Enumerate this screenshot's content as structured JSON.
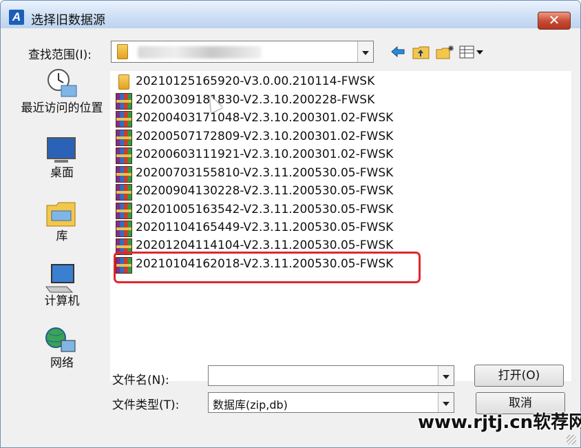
{
  "window": {
    "title": "选择旧数据源",
    "app_icon_letter": "A",
    "close_glyph": "✕"
  },
  "lookin": {
    "label": "查找范围(I):",
    "value": ""
  },
  "toolbar": {
    "back_icon": "back-arrow-icon",
    "up_icon": "up-folder-icon",
    "new_folder_icon": "new-folder-icon",
    "views_icon": "view-menu-icon"
  },
  "places": [
    {
      "label": "最近访问的位置",
      "icon": "recent-places-icon"
    },
    {
      "label": "桌面",
      "icon": "desktop-icon"
    },
    {
      "label": "库",
      "icon": "libraries-icon"
    },
    {
      "label": "计算机",
      "icon": "computer-icon"
    },
    {
      "label": "网络",
      "icon": "network-icon"
    }
  ],
  "files": [
    {
      "name": "20210125165920-V3.0.00.210114-FWSK",
      "type": "folder"
    },
    {
      "name": "20200309181830-V2.3.10.200228-FWSK",
      "type": "rar"
    },
    {
      "name": "20200403171048-V2.3.10.200301.02-FWSK",
      "type": "rar"
    },
    {
      "name": "20200507172809-V2.3.10.200301.02-FWSK",
      "type": "rar"
    },
    {
      "name": "20200603111921-V2.3.10.200301.02-FWSK",
      "type": "rar"
    },
    {
      "name": "20200703155810-V2.3.11.200530.05-FWSK",
      "type": "rar"
    },
    {
      "name": "20200904130228-V2.3.11.200530.05-FWSK",
      "type": "rar"
    },
    {
      "name": "20201005163542-V2.3.11.200530.05-FWSK",
      "type": "rar"
    },
    {
      "name": "20201104165449-V2.3.11.200530.05-FWSK",
      "type": "rar"
    },
    {
      "name": "20201204114104-V2.3.11.200530.05-FWSK",
      "type": "rar"
    },
    {
      "name": "20210104162018-V2.3.11.200530.05-FWSK",
      "type": "rar",
      "highlighted": true
    }
  ],
  "filename": {
    "label": "文件名(N):",
    "value": ""
  },
  "filetype": {
    "label": "文件类型(T):",
    "value": "数据库(zip,db)"
  },
  "buttons": {
    "open": "打开(O)",
    "cancel": "取消"
  },
  "watermark": "www.rjtj.cn软荐网",
  "colors": {
    "highlight_border": "#e0262c",
    "title_bar": "#cfe0f5",
    "close_button": "#c64a32"
  }
}
